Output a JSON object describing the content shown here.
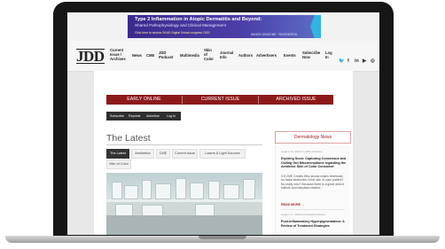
{
  "ad": {
    "title": "Type 2 Inflammation in Atopic Dermatitis and Beyond:",
    "subtitle": "Shared Pathophysiology and Clinical Management",
    "cta": "Click here to access SKAD Digital Virtual congress 2020",
    "sponsor": "SANOFI GENZYME · REGENERON"
  },
  "nav": {
    "logo": "JDD",
    "items": [
      "Current Issue / Archives",
      "News",
      "CME",
      "JDD Podcast",
      "Multimedia",
      "Skin of Color",
      "Journal Info",
      "Authors",
      "Advertisers",
      "Events",
      "Subscribe Now",
      "Log In"
    ],
    "social_icons": [
      "twitter-icon",
      "facebook-icon",
      "linkedin-icon",
      "youtube-icon",
      "instagram-icon"
    ]
  },
  "issue_tabs": [
    "EARLY ONLINE",
    "CURRENT ISSUE",
    "ARCHIVED ISSUE"
  ],
  "sub_links": [
    "Subscribe",
    "Reprints",
    "Advertise",
    "Log In"
  ],
  "main": {
    "heading": "The Latest",
    "filters": [
      "The Latest",
      "Aesthetics",
      "CME",
      "Current Issue",
      "Lasers & Light Sources",
      "Skin of Color"
    ]
  },
  "sidebar": {
    "heading": "Dermatology News",
    "posts": [
      {
        "meta": "August 17, 2020 in CME Activities",
        "title": "Expiring Soon: Capturing Consensus and Calling Out Misconceptions regarding the Aesthetic Skin of Color Consumer",
        "text": "0.5 CME Credits Who knows what's best/most for facial aesthetics in the skin of color patient? No really who? Because there is a great deal of folklore and babyface-related...",
        "more": "READ MORE →"
      },
      {
        "meta": "August 17, 2020 in Featured Articles",
        "title": "Post-Inflammatory Hyperpigmentation: A Review of Treatment Strategies",
        "text": "",
        "more": ""
      }
    ]
  },
  "colors": {
    "brand_red": "#8c1a1a",
    "ad_purple": "#3b2a8c",
    "dark_bar": "#2e2e2e"
  }
}
